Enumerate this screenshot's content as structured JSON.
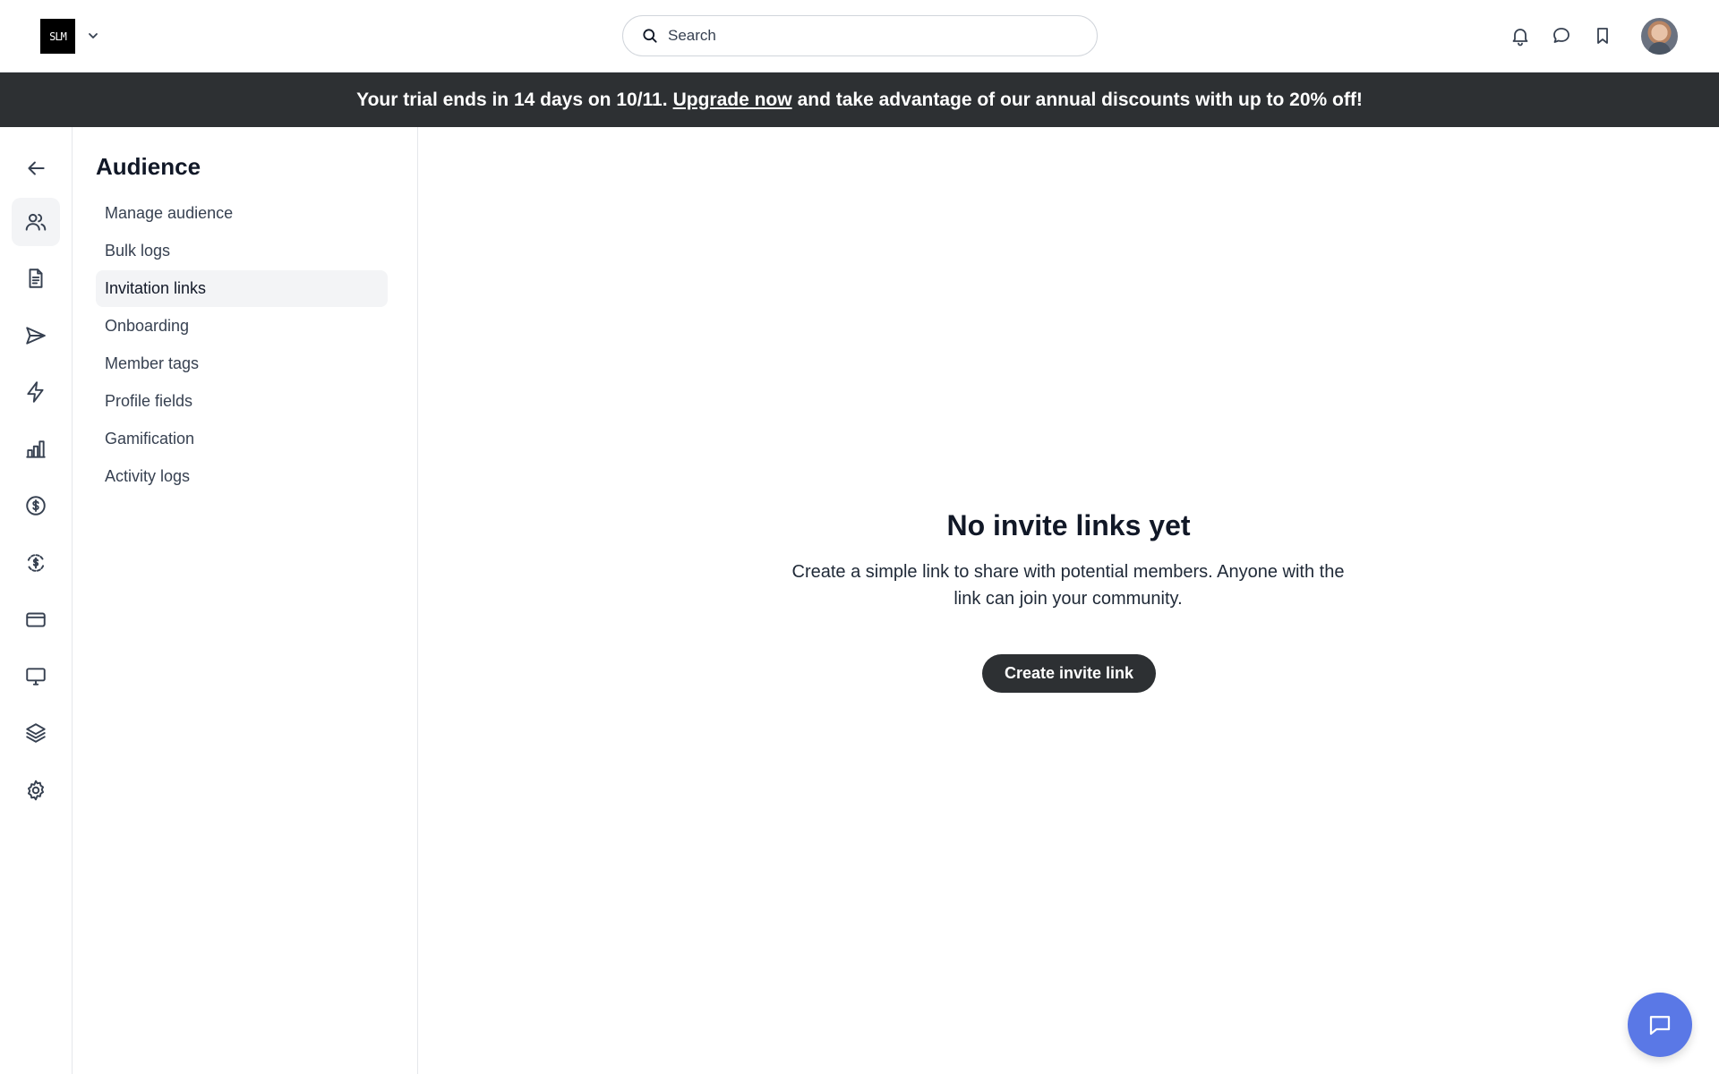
{
  "header": {
    "logo_text": "SLM",
    "search_placeholder": "Search"
  },
  "banner": {
    "prefix": "Your trial ends in 14 days on 10/11.",
    "link": "Upgrade now",
    "suffix": "and take advantage of our annual discounts with up to 20% off!"
  },
  "rail": {
    "items": [
      "back-arrow-icon",
      "users-icon",
      "document-icon",
      "send-icon",
      "lightning-icon",
      "bar-chart-icon",
      "dollar-circle-icon",
      "dollar-refresh-icon",
      "credit-card-icon",
      "monitor-icon",
      "layers-icon",
      "gear-icon"
    ],
    "active": "users-icon"
  },
  "subnav": {
    "title": "Audience",
    "items": [
      {
        "label": "Manage audience"
      },
      {
        "label": "Bulk logs"
      },
      {
        "label": "Invitation links"
      },
      {
        "label": "Onboarding"
      },
      {
        "label": "Member tags"
      },
      {
        "label": "Profile fields"
      },
      {
        "label": "Gamification"
      },
      {
        "label": "Activity logs"
      }
    ],
    "active_index": 2
  },
  "main": {
    "empty_title": "No invite links yet",
    "empty_desc": "Create a simple link to share with potential members. Anyone with the link can join your community.",
    "create_label": "Create invite link"
  },
  "colors": {
    "banner_bg": "#2d3033",
    "fab": "#5a78e6",
    "active_bg": "#f3f4f6"
  }
}
